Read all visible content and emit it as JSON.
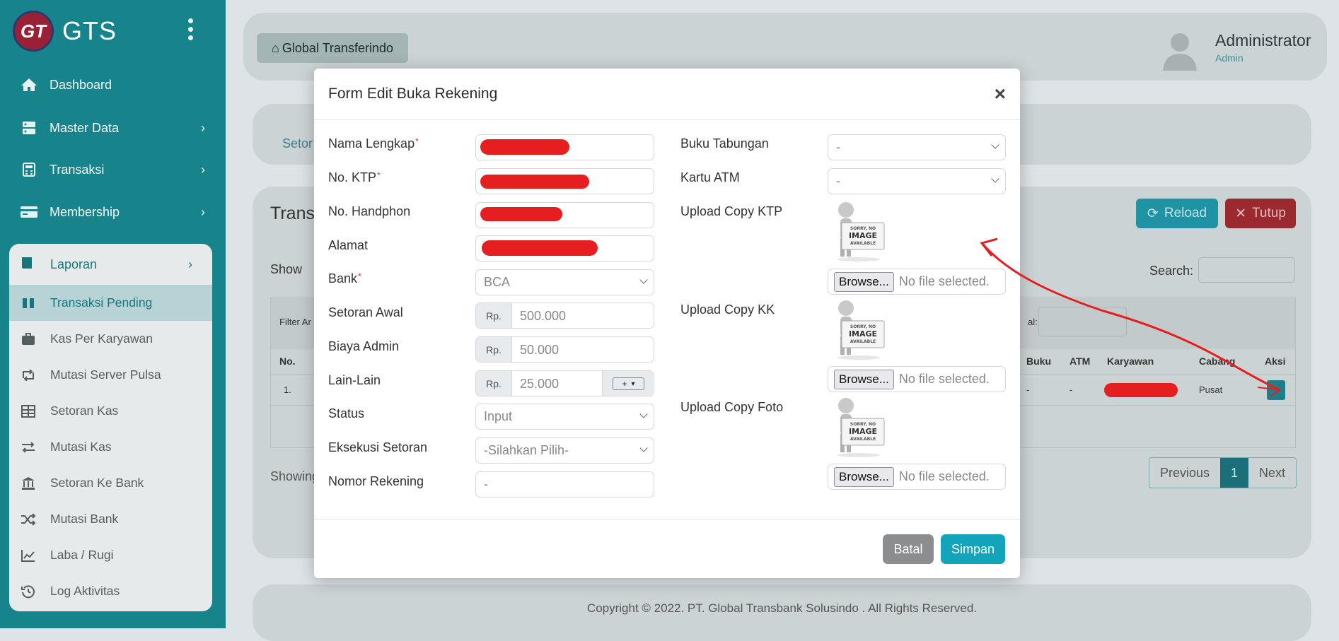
{
  "app": {
    "logo_text": "GTS",
    "logo_mark": "GT"
  },
  "sidebar": {
    "items": [
      {
        "label": "Dashboard",
        "icon": "home-icon"
      },
      {
        "label": "Master Data",
        "icon": "server-icon"
      },
      {
        "label": "Transaksi",
        "icon": "calculator-icon"
      },
      {
        "label": "Membership",
        "icon": "card-icon"
      }
    ],
    "laporan": {
      "label": "Laporan",
      "items": [
        {
          "label": "Transaksi Pending",
          "active": true
        },
        {
          "label": "Kas Per Karyawan"
        },
        {
          "label": "Mutasi Server Pulsa"
        },
        {
          "label": "Setoran Kas"
        },
        {
          "label": "Mutasi Kas"
        },
        {
          "label": "Setoran Ke Bank"
        },
        {
          "label": "Mutasi Bank"
        },
        {
          "label": "Laba / Rugi"
        },
        {
          "label": "Log Aktivitas"
        }
      ]
    }
  },
  "header": {
    "brand": "Global Transferindo",
    "user_name": "Administrator",
    "user_role": "Admin"
  },
  "background": {
    "tab": "Setor",
    "title": "Trans",
    "reload": "Reload",
    "tutup": "Tutup",
    "show": "Show",
    "search": "Search:",
    "filter": "Filter Ar",
    "filter_right": "al:",
    "columns": [
      "No.",
      "Buku",
      "ATM",
      "Karyawan",
      "Cabang",
      "Aksi"
    ],
    "row": {
      "no": "1.",
      "buku": "-",
      "atm": "-",
      "cabang": "Pusat"
    },
    "showing": "Showing",
    "pager": {
      "prev": "Previous",
      "page": "1",
      "next": "Next"
    },
    "footer": "Copyright © 2022. PT. Global Transbank Solusindo . All Rights Reserved."
  },
  "modal": {
    "title": "Form Edit Buka Rekening",
    "close": "×",
    "left": {
      "nama": "Nama Lengkap",
      "ktp": "No. KTP",
      "hp": "No. Handphon",
      "alamat": "Alamat",
      "bank": "Bank",
      "bank_value": "BCA",
      "setoran": "Setoran Awal",
      "setoran_value": "500.000",
      "biaya": "Biaya Admin",
      "biaya_value": "50.000",
      "lain": "Lain-Lain",
      "lain_value": "25.000",
      "plus": "+",
      "rp": "Rp.",
      "status": "Status",
      "status_value": "Input",
      "eksekusi": "Eksekusi Setoran",
      "eksekusi_value": "-Silahkan Pilih-",
      "nomor": "Nomor Rekening",
      "nomor_value": "-",
      "required": "*"
    },
    "right": {
      "buku": "Buku Tabungan",
      "buku_value": "-",
      "atm": "Kartu ATM",
      "atm_value": "-",
      "upload_ktp": "Upload Copy KTP",
      "upload_kk": "Upload Copy KK",
      "upload_foto": "Upload Copy Foto",
      "browse": "Browse...",
      "no_file": "No file selected.",
      "noimg_line1": "SORRY, NO",
      "noimg_line2": "IMAGE",
      "noimg_line3": "AVAILABLE"
    },
    "buttons": {
      "batal": "Batal",
      "simpan": "Simpan"
    }
  },
  "colors": {
    "sidebar": "#17838a",
    "primary": "#13a4ba",
    "annotation": "#e51f1f"
  }
}
